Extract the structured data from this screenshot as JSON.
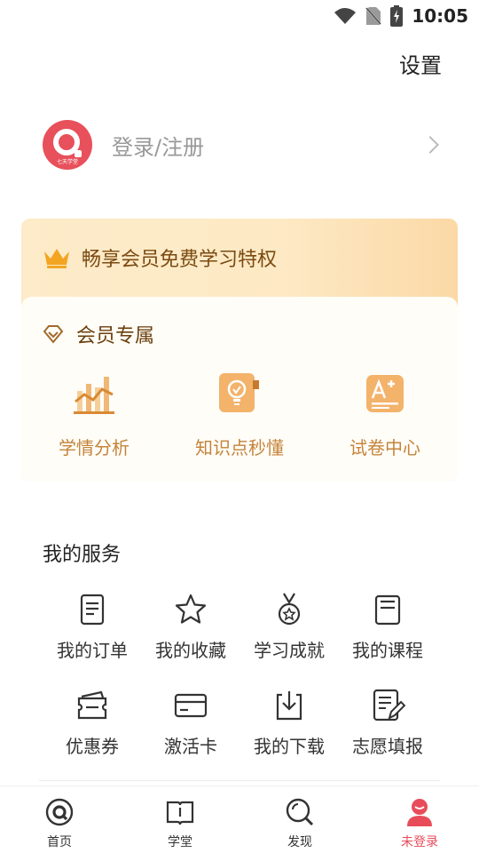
{
  "status_bar": {
    "time": "10:05"
  },
  "header": {
    "settings_label": "设置"
  },
  "profile": {
    "login_label": "登录/注册",
    "avatar_brand": "七天学堂"
  },
  "member_card": {
    "title": "畅享会员免费学习特权",
    "exclusive_label": "会员专属",
    "perks": [
      {
        "label": "学情分析",
        "icon": "bar-chart-icon"
      },
      {
        "label": "知识点秒懂",
        "icon": "lightbulb-icon"
      },
      {
        "label": "试卷中心",
        "icon": "exam-paper-icon"
      }
    ]
  },
  "services": {
    "title": "我的服务",
    "items": [
      {
        "label": "我的订单",
        "icon": "order-list-icon"
      },
      {
        "label": "我的收藏",
        "icon": "star-icon"
      },
      {
        "label": "学习成就",
        "icon": "medal-icon"
      },
      {
        "label": "我的课程",
        "icon": "course-book-icon"
      },
      {
        "label": "优惠券",
        "icon": "coupon-icon"
      },
      {
        "label": "激活卡",
        "icon": "card-icon"
      },
      {
        "label": "我的下载",
        "icon": "download-icon"
      },
      {
        "label": "志愿填报",
        "icon": "edit-form-icon"
      }
    ]
  },
  "bottom_nav": {
    "items": [
      {
        "label": "首页",
        "icon": "home-logo-icon"
      },
      {
        "label": "学堂",
        "icon": "open-book-icon"
      },
      {
        "label": "发现",
        "icon": "search-icon"
      },
      {
        "label": "未登录",
        "icon": "user-icon"
      }
    ],
    "active_index": 3
  },
  "colors": {
    "accent": "#e84c5a",
    "gold_text": "#c4843a",
    "card_gold": "#fbd9a6"
  }
}
